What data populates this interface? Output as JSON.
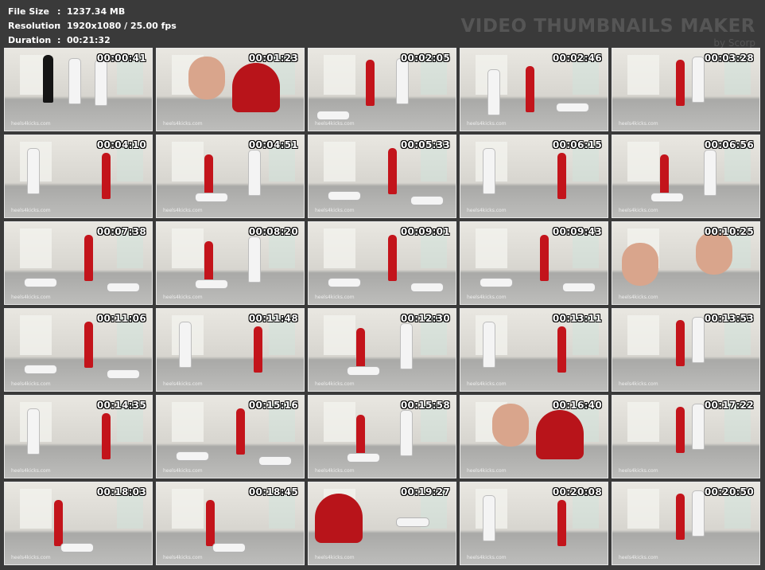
{
  "info": {
    "file_size_label": "File Size",
    "file_size_value": "1237.34 MB",
    "resolution_label": "Resolution",
    "resolution_value": "1920x1080 / 25.00 fps",
    "duration_label": "Duration",
    "duration_value": "00:21:32",
    "separator": ":"
  },
  "brand": {
    "title": "VIDEO THUMBNAILS MAKER",
    "subtitle": "by Scorp"
  },
  "watermark": "heels4kicks.com",
  "thumbnails": [
    {
      "time": "00:00:41",
      "scene": "dark_figure_whites"
    },
    {
      "time": "00:01:23",
      "scene": "closeup_pair"
    },
    {
      "time": "00:02:05",
      "scene": "red_white_standing"
    },
    {
      "time": "00:02:46",
      "scene": "wide_floor"
    },
    {
      "time": "00:03:28",
      "scene": "red_white_close"
    },
    {
      "time": "00:04:10",
      "scene": "red_white_pair"
    },
    {
      "time": "00:04:51",
      "scene": "red_white_far"
    },
    {
      "time": "00:05:33",
      "scene": "red_center_floor"
    },
    {
      "time": "00:06:15",
      "scene": "red_white_pair"
    },
    {
      "time": "00:06:56",
      "scene": "red_white_far"
    },
    {
      "time": "00:07:38",
      "scene": "red_center_floor"
    },
    {
      "time": "00:08:20",
      "scene": "red_white_far"
    },
    {
      "time": "00:09:01",
      "scene": "red_center_floor"
    },
    {
      "time": "00:09:43",
      "scene": "red_center_floor"
    },
    {
      "time": "00:10:25",
      "scene": "closeup_faces"
    },
    {
      "time": "00:11:06",
      "scene": "red_center_floor"
    },
    {
      "time": "00:11:48",
      "scene": "red_white_pair"
    },
    {
      "time": "00:12:30",
      "scene": "red_white_far"
    },
    {
      "time": "00:13:11",
      "scene": "red_white_pair"
    },
    {
      "time": "00:13:53",
      "scene": "red_white_close"
    },
    {
      "time": "00:14:35",
      "scene": "red_white_pair"
    },
    {
      "time": "00:15:16",
      "scene": "red_center_floor"
    },
    {
      "time": "00:15:58",
      "scene": "red_white_far"
    },
    {
      "time": "00:16:40",
      "scene": "closeup_pair"
    },
    {
      "time": "00:17:22",
      "scene": "red_white_close"
    },
    {
      "time": "00:18:03",
      "scene": "red_on_floor"
    },
    {
      "time": "00:18:45",
      "scene": "red_on_floor"
    },
    {
      "time": "00:19:27",
      "scene": "red_close_floor"
    },
    {
      "time": "00:20:08",
      "scene": "red_white_pair"
    },
    {
      "time": "00:20:50",
      "scene": "red_white_close"
    }
  ]
}
